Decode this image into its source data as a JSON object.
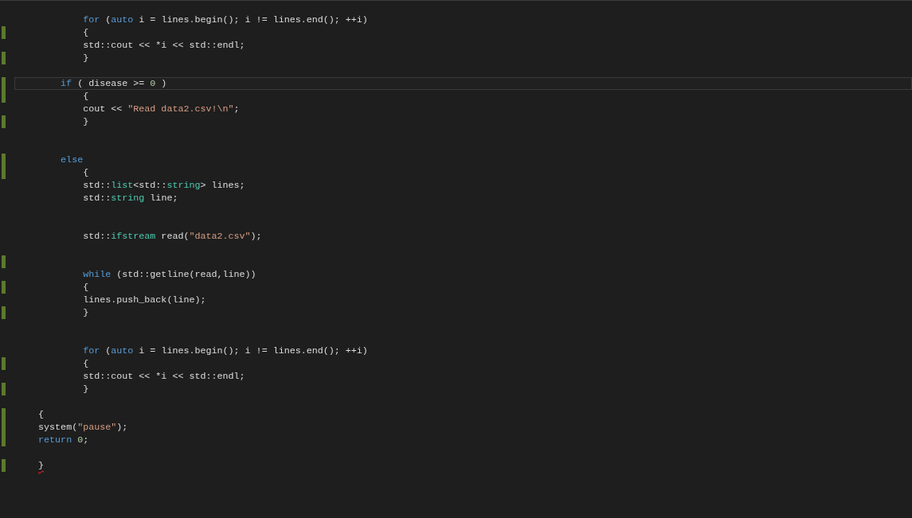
{
  "editor": {
    "lines": [
      {
        "changed": false,
        "tokens": [
          {
            "kind": "keyword",
            "text": "            for"
          },
          {
            "kind": "plain",
            "text": " ("
          },
          {
            "kind": "keyword",
            "text": "auto"
          },
          {
            "kind": "plain",
            "text": " i = lines.begin(); i != lines.end(); ++i)"
          }
        ]
      },
      {
        "changed": true,
        "tokens": [
          {
            "kind": "plain",
            "text": "            {"
          }
        ]
      },
      {
        "changed": false,
        "tokens": [
          {
            "kind": "plain",
            "text": "            std::cout << *i << std::endl;"
          }
        ]
      },
      {
        "changed": true,
        "tokens": [
          {
            "kind": "plain",
            "text": "            }"
          }
        ]
      },
      {
        "changed": false
      },
      {
        "changed": true,
        "current": true,
        "tokens": [
          {
            "kind": "keyword",
            "text": "        if"
          },
          {
            "kind": "plain",
            "text": " ( disease >= "
          },
          {
            "kind": "number",
            "text": "0"
          },
          {
            "kind": "plain",
            "text": " )"
          }
        ]
      },
      {
        "changed": true,
        "tokens": [
          {
            "kind": "plain",
            "text": "            {"
          }
        ]
      },
      {
        "changed": false,
        "tokens": [
          {
            "kind": "plain",
            "text": "            cout << "
          },
          {
            "kind": "string",
            "text": "\"Read data2.csv!\\n\""
          },
          {
            "kind": "plain",
            "text": ";"
          }
        ]
      },
      {
        "changed": true,
        "tokens": [
          {
            "kind": "plain",
            "text": "            }"
          }
        ]
      },
      {
        "changed": false
      },
      {
        "changed": false
      },
      {
        "changed": true,
        "tokens": [
          {
            "kind": "keyword",
            "text": "        else"
          }
        ]
      },
      {
        "changed": true,
        "tokens": [
          {
            "kind": "plain",
            "text": "            {"
          }
        ]
      },
      {
        "changed": false,
        "tokens": [
          {
            "kind": "plain",
            "text": "            std::"
          },
          {
            "kind": "type",
            "text": "list"
          },
          {
            "kind": "plain",
            "text": "<std::"
          },
          {
            "kind": "type",
            "text": "string"
          },
          {
            "kind": "plain",
            "text": "> lines;"
          }
        ]
      },
      {
        "changed": false,
        "tokens": [
          {
            "kind": "plain",
            "text": "            std::"
          },
          {
            "kind": "type",
            "text": "string"
          },
          {
            "kind": "plain",
            "text": " line;"
          }
        ]
      },
      {
        "changed": false
      },
      {
        "changed": false
      },
      {
        "changed": false,
        "tokens": [
          {
            "kind": "plain",
            "text": "            std::"
          },
          {
            "kind": "type",
            "text": "ifstream"
          },
          {
            "kind": "plain",
            "text": " read("
          },
          {
            "kind": "string",
            "text": "\"data2.csv\""
          },
          {
            "kind": "plain",
            "text": ");"
          }
        ]
      },
      {
        "changed": false
      },
      {
        "changed": true
      },
      {
        "changed": false,
        "tokens": [
          {
            "kind": "keyword",
            "text": "            while"
          },
          {
            "kind": "plain",
            "text": " (std::getline(read,line))"
          }
        ]
      },
      {
        "changed": true,
        "tokens": [
          {
            "kind": "plain",
            "text": "            {"
          }
        ]
      },
      {
        "changed": false,
        "tokens": [
          {
            "kind": "plain",
            "text": "            lines.push_back(line);"
          }
        ]
      },
      {
        "changed": true,
        "tokens": [
          {
            "kind": "plain",
            "text": "            }"
          }
        ]
      },
      {
        "changed": false
      },
      {
        "changed": false
      },
      {
        "changed": false,
        "tokens": [
          {
            "kind": "keyword",
            "text": "            for"
          },
          {
            "kind": "plain",
            "text": " ("
          },
          {
            "kind": "keyword",
            "text": "auto"
          },
          {
            "kind": "plain",
            "text": " i = lines.begin(); i != lines.end(); ++i)"
          }
        ]
      },
      {
        "changed": true,
        "tokens": [
          {
            "kind": "plain",
            "text": "            {"
          }
        ]
      },
      {
        "changed": false,
        "tokens": [
          {
            "kind": "plain",
            "text": "            std::cout << *i << std::endl;"
          }
        ]
      },
      {
        "changed": true,
        "tokens": [
          {
            "kind": "plain",
            "text": "            }"
          }
        ]
      },
      {
        "changed": false
      },
      {
        "changed": true,
        "tokens": [
          {
            "kind": "plain",
            "text": "    {"
          }
        ]
      },
      {
        "changed": true,
        "tokens": [
          {
            "kind": "plain",
            "text": "    system("
          },
          {
            "kind": "string",
            "text": "\"pause\""
          },
          {
            "kind": "plain",
            "text": ");"
          }
        ]
      },
      {
        "changed": true,
        "tokens": [
          {
            "kind": "keyword",
            "text": "    return"
          },
          {
            "kind": "number",
            "text": " 0"
          },
          {
            "kind": "plain",
            "text": ";"
          }
        ]
      },
      {
        "changed": false
      },
      {
        "changed": true,
        "error": true,
        "tokens": [
          {
            "kind": "plain",
            "text": "    }"
          }
        ]
      }
    ]
  }
}
